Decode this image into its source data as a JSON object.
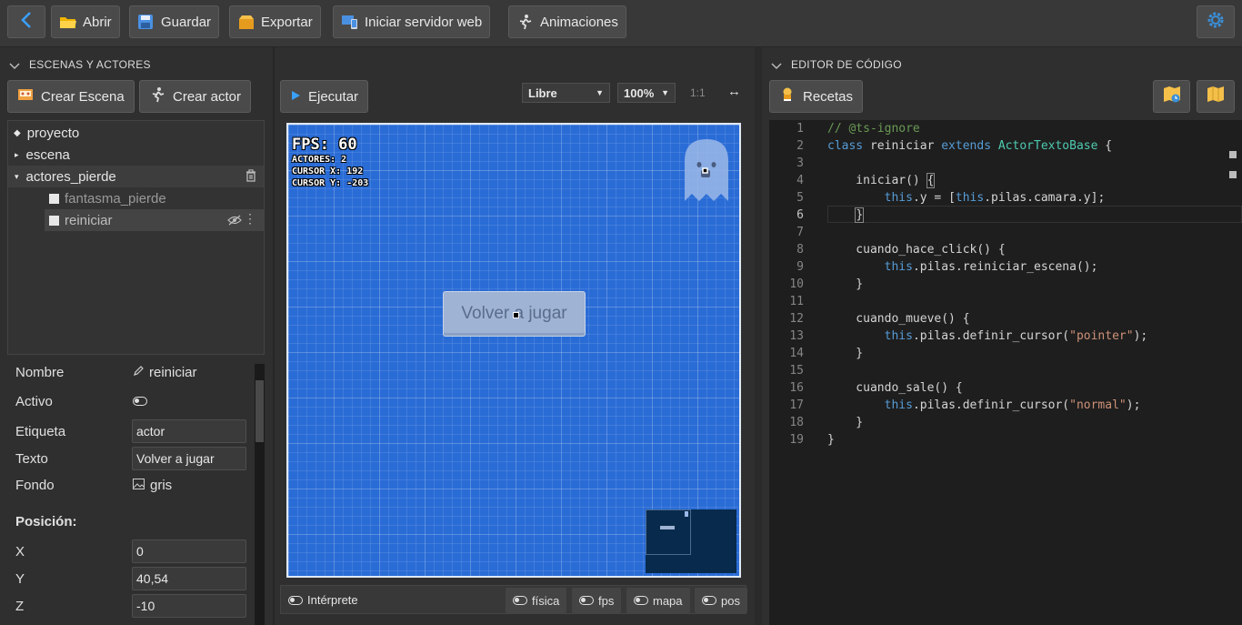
{
  "toolbar": {
    "abrir": "Abrir",
    "guardar": "Guardar",
    "exportar": "Exportar",
    "servidor": "Iniciar servidor web",
    "animaciones": "Animaciones"
  },
  "left_panel": {
    "title": "ESCENAS Y ACTORES",
    "crear_escena": "Crear Escena",
    "crear_actor": "Crear actor",
    "tree": [
      {
        "label": "proyecto"
      },
      {
        "label": "escena"
      },
      {
        "label": "actores_pierde"
      },
      {
        "label": "fantasma_pierde"
      },
      {
        "label": "reiniciar"
      }
    ]
  },
  "properties": {
    "nombre_label": "Nombre",
    "nombre_value": "reiniciar",
    "activo_label": "Activo",
    "etiqueta_label": "Etiqueta",
    "etiqueta_value": "actor",
    "texto_label": "Texto",
    "texto_value": "Volver a jugar",
    "fondo_label": "Fondo",
    "fondo_value": "gris",
    "posicion_label": "Posición:",
    "x_label": "X",
    "x_value": "0",
    "y_label": "Y",
    "y_value": "40,54",
    "z_label": "Z",
    "z_value": "-10"
  },
  "center": {
    "ejecutar": "Ejecutar",
    "mode_select": "Libre",
    "zoom_select": "100%",
    "ratio": "1:1",
    "hud": {
      "fps": "FPS: 60",
      "actores": "ACTORES: 2",
      "cursor_x": "CURSOR X: 192",
      "cursor_y": "CURSOR Y: -203"
    },
    "game_button": "Volver a jugar",
    "bottom": {
      "interprete": "Intérprete",
      "fisica": "física",
      "fps": "fps",
      "mapa": "mapa",
      "pos": "pos"
    }
  },
  "right_panel": {
    "title": "EDITOR DE CÓDIGO",
    "recetas": "Recetas"
  },
  "code": {
    "lines": [
      {
        "n": "1",
        "text": "// @ts-ignore"
      },
      {
        "n": "2",
        "text": "class reiniciar extends ActorTextoBase {"
      },
      {
        "n": "3",
        "text": ""
      },
      {
        "n": "4",
        "text": "    iniciar() {"
      },
      {
        "n": "5",
        "text": "        this.y = [this.pilas.camara.y];"
      },
      {
        "n": "6",
        "text": "    }"
      },
      {
        "n": "7",
        "text": ""
      },
      {
        "n": "8",
        "text": "    cuando_hace_click() {"
      },
      {
        "n": "9",
        "text": "        this.pilas.reiniciar_escena();"
      },
      {
        "n": "10",
        "text": "    }"
      },
      {
        "n": "11",
        "text": ""
      },
      {
        "n": "12",
        "text": "    cuando_mueve() {"
      },
      {
        "n": "13",
        "text": "        this.pilas.definir_cursor(\"pointer\");"
      },
      {
        "n": "14",
        "text": "    }"
      },
      {
        "n": "15",
        "text": ""
      },
      {
        "n": "16",
        "text": "    cuando_sale() {"
      },
      {
        "n": "17",
        "text": "        this.pilas.definir_cursor(\"normal\");"
      },
      {
        "n": "18",
        "text": "    }"
      },
      {
        "n": "19",
        "text": "}"
      }
    ]
  },
  "colors": {
    "canvas_bg": "#2a6cd6",
    "editor_bg": "#1e1e1e",
    "accent": "#3aa0ff"
  }
}
